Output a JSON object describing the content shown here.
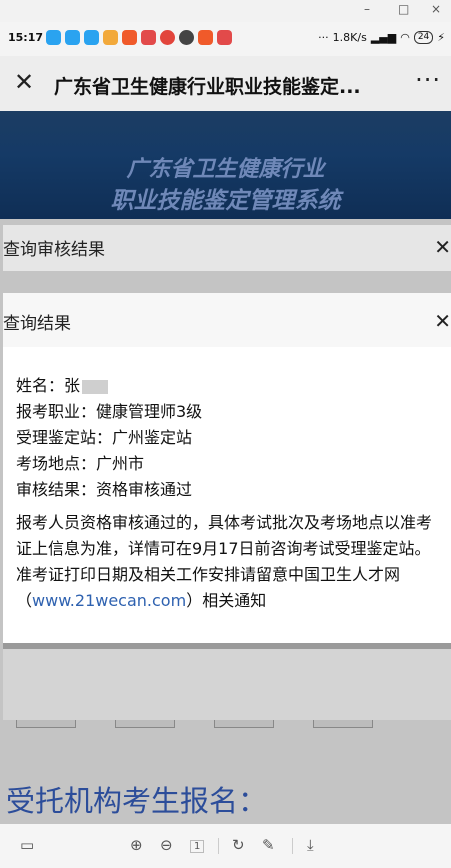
{
  "window": {
    "minimize": "–",
    "maximize": "□",
    "close": "×"
  },
  "status": {
    "time": "15:17",
    "speed": "1.8K/s",
    "battery": "24",
    "more": "···"
  },
  "titlebar": {
    "title": "广东省卫生健康行业职业技能鉴定...",
    "more": "···"
  },
  "banner": {
    "line1": "广东省卫生健康行业",
    "line2": "职业技能鉴定管理系统"
  },
  "dialog_back": {
    "title": "查询审核结果"
  },
  "dialog": {
    "title": "查询结果",
    "name_label": "姓名：张",
    "job": "报考职业：健康管理师3级",
    "station": "受理鉴定站：广州鉴定站",
    "location": "考场地点：广州市",
    "result": "审核结果：资格审核通过",
    "note": "报考人员资格审核通过的，具体考试批次及考场地点以准考证上信息为准，详情可在9月17日前咨询考试受理鉴定站。准考证打印日期及相关工作安排请留意中国卫生人才网",
    "link_open": "（",
    "link": "www.21wecan.com",
    "link_close": "）相关通知"
  },
  "background": {
    "heading": "受托机构考生报名："
  },
  "toolbar": {
    "page_input": "1"
  }
}
